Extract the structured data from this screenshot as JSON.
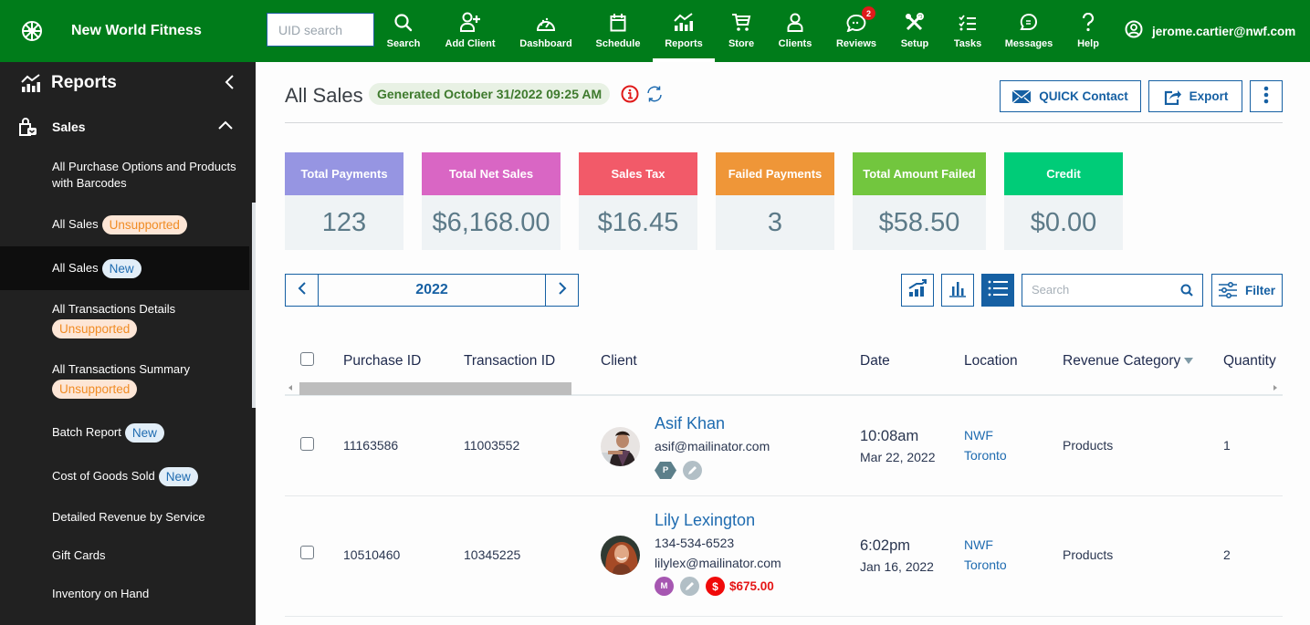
{
  "app": {
    "brand_name": "New World Fitness",
    "uid_search_placeholder": "UID search",
    "nav": [
      {
        "label": "Search",
        "icon": "search-icon"
      },
      {
        "label": "Add Client",
        "icon": "add-user-icon"
      },
      {
        "label": "Dashboard",
        "icon": "dashboard-gauge-icon"
      },
      {
        "label": "Schedule",
        "icon": "calendar-icon"
      },
      {
        "label": "Reports",
        "icon": "reports-chart-icon",
        "active": true
      },
      {
        "label": "Store",
        "icon": "cart-icon"
      },
      {
        "label": "Clients",
        "icon": "person-icon"
      },
      {
        "label": "Reviews",
        "icon": "chat-bubble-icon",
        "badge": "2"
      },
      {
        "label": "Setup",
        "icon": "tools-icon"
      },
      {
        "label": "Tasks",
        "icon": "checklist-icon"
      },
      {
        "label": "Messages",
        "icon": "message-icon"
      },
      {
        "label": "Help",
        "icon": "question-icon"
      }
    ],
    "user_email": "jerome.cartier@nwf.com",
    "colors": {
      "brand_green": "#007c1a",
      "primary_blue": "#1660a3",
      "badge_red": "#e01a1a"
    }
  },
  "sidebar": {
    "title": "Reports",
    "section": "Sales",
    "items": [
      {
        "label": "All Purchase Options and Products with Barcodes",
        "pill": null
      },
      {
        "label": "All Sales",
        "pill": "Unsupported"
      },
      {
        "label": "All Sales",
        "pill": "New",
        "active": true
      },
      {
        "label": "All Transactions Details",
        "pill": "Unsupported"
      },
      {
        "label": "All Transactions Summary",
        "pill": "Unsupported"
      },
      {
        "label": "Batch Report",
        "pill": "New"
      },
      {
        "label": "Cost of Goods Sold",
        "pill": "New"
      },
      {
        "label": "Detailed Revenue by Service",
        "pill": null
      },
      {
        "label": "Gift Cards",
        "pill": null
      },
      {
        "label": "Inventory on Hand",
        "pill": null
      }
    ]
  },
  "page": {
    "title": "All Sales",
    "generated": "Generated October 31/2022 09:25 AM",
    "quick_contact_label": "QUICK Contact",
    "export_label": "Export"
  },
  "stats": [
    {
      "label": "Total Payments",
      "value": "123",
      "color": "#9695e2"
    },
    {
      "label": "Total Net Sales",
      "value": "$6,168.00",
      "color": "#d966c4"
    },
    {
      "label": "Sales Tax",
      "value": "$16.45",
      "color": "#f25a69"
    },
    {
      "label": "Failed Payments",
      "value": "3",
      "color": "#ef9638"
    },
    {
      "label": "Total Amount Failed",
      "value": "$58.50",
      "color": "#72c63e"
    },
    {
      "label": "Credit",
      "value": "$0.00",
      "color": "#00cc78"
    }
  ],
  "toolbar": {
    "year": "2022",
    "search_placeholder": "Search",
    "filter_label": "Filter",
    "active_view": "list"
  },
  "table": {
    "columns": [
      "Purchase ID",
      "Transaction ID",
      "Client",
      "Date",
      "Location",
      "Revenue Category",
      "Quantity"
    ],
    "sorted_column": "Revenue Category",
    "rows": [
      {
        "purchase_id": "11163586",
        "transaction_id": "11003552",
        "client_name": "Asif Khan",
        "client_phone": "",
        "client_email": "asif@mailinator.com",
        "tags": [
          {
            "letter": "P",
            "shape": "hex",
            "color": "#5c7f8a"
          },
          {
            "letter": "",
            "shape": "circle",
            "color": "#b2bfc6",
            "icon": "pencil-icon"
          }
        ],
        "amount_due": "",
        "time": "10:08am",
        "date": "Mar 22, 2022",
        "location_line1": "NWF",
        "location_line2": "Toronto",
        "revenue_category": "Products",
        "quantity": "1"
      },
      {
        "purchase_id": "10510460",
        "transaction_id": "10345225",
        "client_name": "Lily Lexington",
        "client_phone": "134-534-6523",
        "client_email": "lilylex@mailinator.com",
        "tags": [
          {
            "letter": "M",
            "shape": "circle",
            "color": "#a657b1"
          },
          {
            "letter": "",
            "shape": "circle",
            "color": "#b2bfc6",
            "icon": "pencil-icon"
          },
          {
            "letter": "$",
            "shape": "circle",
            "color": "#f00a0a",
            "icon": "dollar-icon"
          }
        ],
        "amount_due": "$675.00",
        "time": "6:02pm",
        "date": "Jan 16, 2022",
        "location_line1": "NWF",
        "location_line2": "Toronto",
        "revenue_category": "Products",
        "quantity": "2"
      }
    ]
  }
}
